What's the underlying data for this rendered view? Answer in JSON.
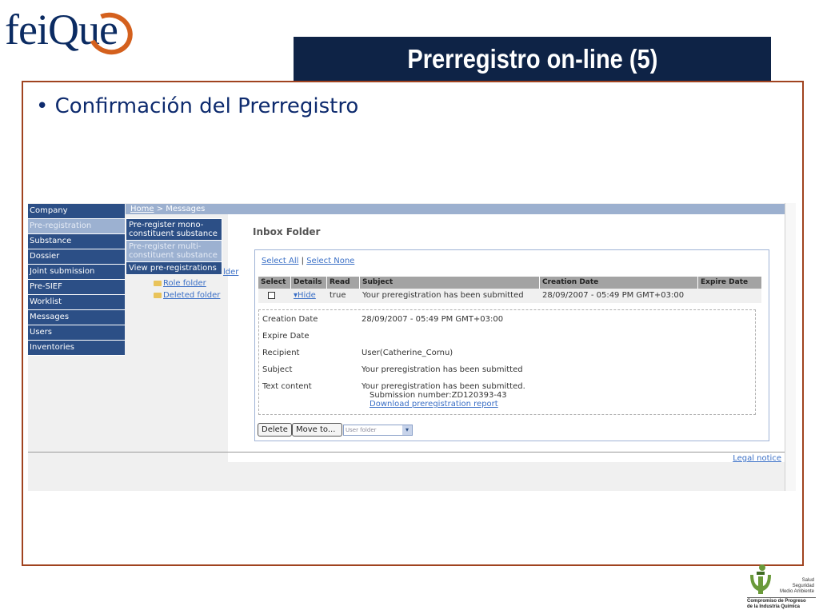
{
  "brand": {
    "logo_text_1": "fei",
    "logo_text_2": "Que"
  },
  "slide": {
    "title": "Prerregistro on-line (5)",
    "bullet": "• Confirmación del Prerregistro"
  },
  "app": {
    "breadcrumb": {
      "home": "Home",
      "rest": " > Messages"
    },
    "sidebar": {
      "items": [
        {
          "label": "Company"
        },
        {
          "label": "Pre-registration"
        },
        {
          "label": "Substance"
        },
        {
          "label": "Dossier"
        },
        {
          "label": "Joint submission"
        },
        {
          "label": "Pre-SIEF"
        },
        {
          "label": "Worklist"
        },
        {
          "label": "Messages"
        },
        {
          "label": "Users"
        },
        {
          "label": "Inventories"
        }
      ]
    },
    "submenu": {
      "items": [
        {
          "label": "Pre-register mono-constituent substance"
        },
        {
          "label": "Pre-register multi-constituent substance"
        },
        {
          "label": "View pre-registrations"
        }
      ]
    },
    "folders": {
      "partial": "lder",
      "role": "Role folder",
      "deleted": "Deleted folder"
    },
    "inbox": {
      "title": "Inbox Folder",
      "select_all": "Select All",
      "separator": "|",
      "select_none": "Select None",
      "columns": [
        "Select",
        "Details",
        "Read",
        "Subject",
        "Creation Date",
        "Expire Date"
      ],
      "row": {
        "details": "▾Hide",
        "read": "true",
        "subject": "Your preregistration has been submitted",
        "creation_date": "28/09/2007 - 05:49 PM GMT+03:00",
        "expire_date": ""
      },
      "details": {
        "creation_date_label": "Creation Date",
        "creation_date_value": "28/09/2007 - 05:49 PM GMT+03:00",
        "expire_date_label": "Expire Date",
        "expire_date_value": "",
        "recipient_label": "Recipient",
        "recipient_value": "User(Catherine_Cornu)",
        "subject_label": "Subject",
        "subject_value": "Your preregistration has been submitted",
        "text_label": "Text content",
        "text_line1": "Your preregistration has been submitted.",
        "text_line2": "Submission number:ZD120393-43",
        "download_link": "Download preregistration report"
      },
      "buttons": {
        "delete": "Delete",
        "move_to": "Move to...",
        "folder_select": "User folder"
      }
    },
    "legal_notice": "Legal notice"
  },
  "footer_badge": {
    "line1": "Salud",
    "line2": "Seguridad",
    "line3": "Medio Ambiente",
    "line4": "Compromiso de Progreso",
    "line5": "de la Industria Química"
  },
  "colors": {
    "title_bar": "#0e2346",
    "frame_border": "#a0431f",
    "nav_blue": "#2c4f86",
    "link_blue": "#3a6fc6"
  }
}
